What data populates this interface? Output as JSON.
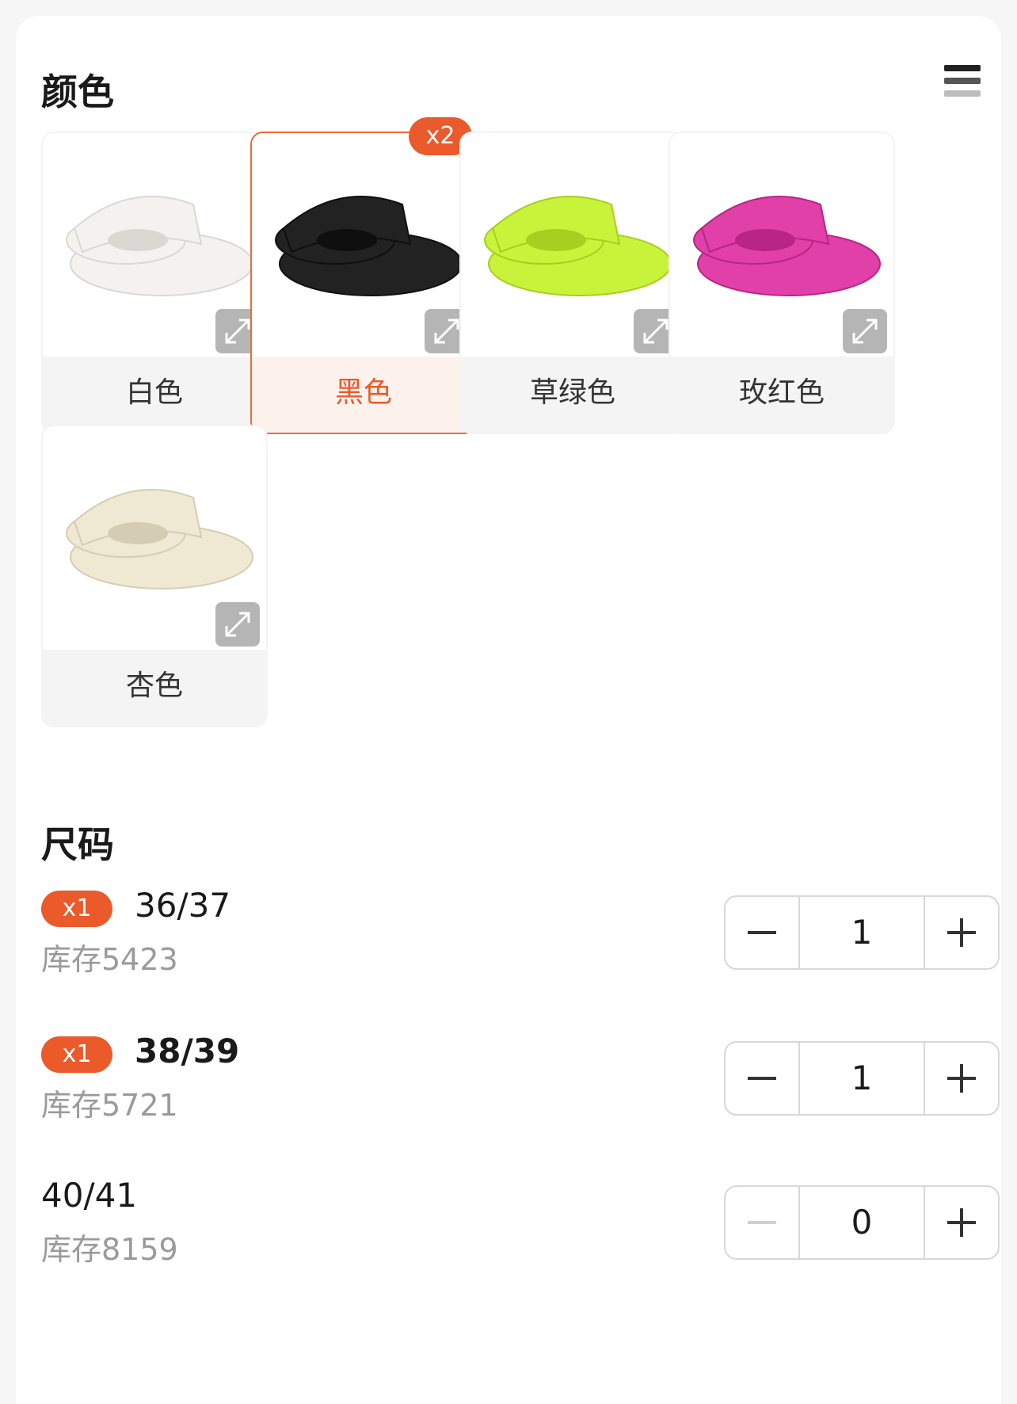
{
  "color_section": {
    "title": "颜色",
    "options": [
      {
        "label": "白色",
        "color": "#f3f2ee",
        "shade": "#d9d8d2",
        "selected": false
      },
      {
        "label": "黑色",
        "color": "#222222",
        "shade": "#0f0f0f",
        "selected": true,
        "count": "x2"
      },
      {
        "label": "草绿色",
        "color": "#c9f23a",
        "shade": "#a6cf1f",
        "selected": false
      },
      {
        "label": "玫红色",
        "color": "#e040a8",
        "shade": "#b82585",
        "selected": false
      },
      {
        "label": "杏色",
        "color": "#efe8d2",
        "shade": "#d5cdb3",
        "selected": false
      }
    ]
  },
  "size_section": {
    "title": "尺码",
    "sizes": [
      {
        "name": "36/37",
        "stock": "库存5423",
        "qty_badge": "x1",
        "quantity": "1"
      },
      {
        "name": "38/39",
        "stock": "库存5721",
        "qty_badge": "x1",
        "quantity": "1"
      },
      {
        "name": "40/41",
        "stock": "库存8159",
        "quantity": "0"
      }
    ]
  },
  "colors": {
    "accent": "#ea5a2a",
    "selected_border": "#ef6a3a",
    "muted_text": "#9a9a9a"
  }
}
